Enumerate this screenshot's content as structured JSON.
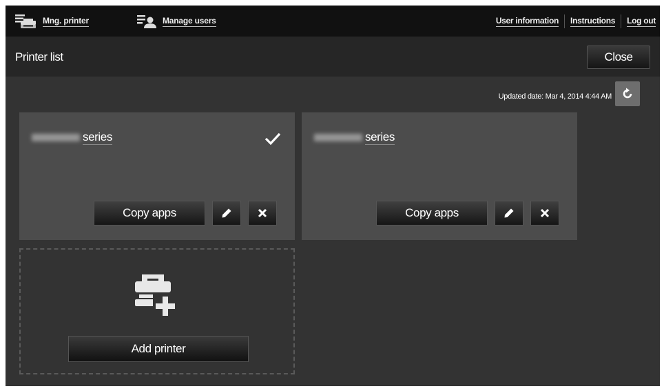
{
  "nav": {
    "mng_printer": "Mng. printer",
    "manage_users": "Manage users",
    "user_information": "User information",
    "instructions": "Instructions",
    "log_out": "Log out"
  },
  "header": {
    "title": "Printer list",
    "close_label": "Close"
  },
  "updated": {
    "text": "Updated date: Mar 4, 2014 4:44 AM"
  },
  "printers": [
    {
      "name_suffix": "series",
      "selected": true,
      "copy_label": "Copy apps"
    },
    {
      "name_suffix": "series",
      "selected": false,
      "copy_label": "Copy apps"
    }
  ],
  "add_printer": {
    "label": "Add printer"
  },
  "icons": {
    "mng_printer": "printer-list-icon",
    "manage_users": "user-list-icon",
    "refresh": "refresh-icon",
    "check": "checkmark-icon",
    "edit": "pencil-icon",
    "delete": "close-icon",
    "add_printer": "add-printer-icon"
  },
  "colors": {
    "topbar": "#111111",
    "background": "#333333",
    "titlebar": "#262626",
    "card": "#4c4c4c",
    "refresh_button": "#6e6e6e"
  }
}
